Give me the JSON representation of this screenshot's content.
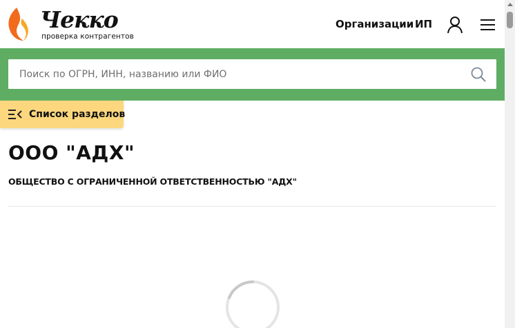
{
  "header": {
    "logo": {
      "wordmark": "Чекко",
      "tagline": "проверка контрагентов",
      "flame_colors": [
        "#f26b1d",
        "#f9a825"
      ]
    },
    "nav": {
      "organizations": "Организации",
      "ip": "ИП"
    },
    "icons": {
      "user": "user-icon",
      "menu": "menu-icon"
    }
  },
  "search": {
    "placeholder": "Поиск по ОГРН, ИНН, названию или ФИО",
    "value": "",
    "icon": "search-icon",
    "band_color": "#5fad63"
  },
  "sections_button": {
    "label": "Список разделов",
    "icon": "list-collapse-icon",
    "color": "#fcd77e"
  },
  "company": {
    "short_name": "ООО \"АДХ\"",
    "full_name": "ОБЩЕСТВО С ОГРАНИЧЕННОЙ ОТВЕТСТВЕННОСТЬЮ \"АДХ\""
  },
  "loading": {
    "icon": "spinner-icon"
  }
}
